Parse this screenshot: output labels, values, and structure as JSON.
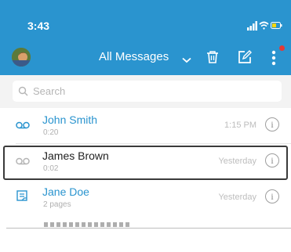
{
  "status_bar": {
    "time": "3:43"
  },
  "toolbar": {
    "mailbox_label": "All Messages"
  },
  "search": {
    "placeholder": "Search"
  },
  "messages": [
    {
      "name": "John Smith",
      "detail": "0:20",
      "when": "1:15 PM",
      "type_icon": "voicemail-icon",
      "info_icon": "info-icon",
      "name_color": "#2a94cf",
      "selected": false
    },
    {
      "name": "James Brown",
      "detail": "0:02",
      "when": "Yesterday",
      "type_icon": "voicemail-icon",
      "info_icon": "info-icon",
      "name_color": "#222222",
      "selected": true
    },
    {
      "name": "Jane Doe",
      "detail": "2 pages",
      "when": "Yesterday",
      "type_icon": "fax-icon",
      "info_icon": "info-icon",
      "name_color": "#2a94cf",
      "selected": false
    }
  ],
  "colors": {
    "header": "#2a94cf",
    "accent": "#2a94cf",
    "badge": "#e53935",
    "selection_border": "#3a3a3a"
  },
  "icons": [
    "signal-icon",
    "wifi-icon",
    "battery-icon",
    "avatar",
    "chevron-down-icon",
    "trash-icon",
    "compose-icon",
    "more-vertical-icon",
    "search-icon"
  ]
}
